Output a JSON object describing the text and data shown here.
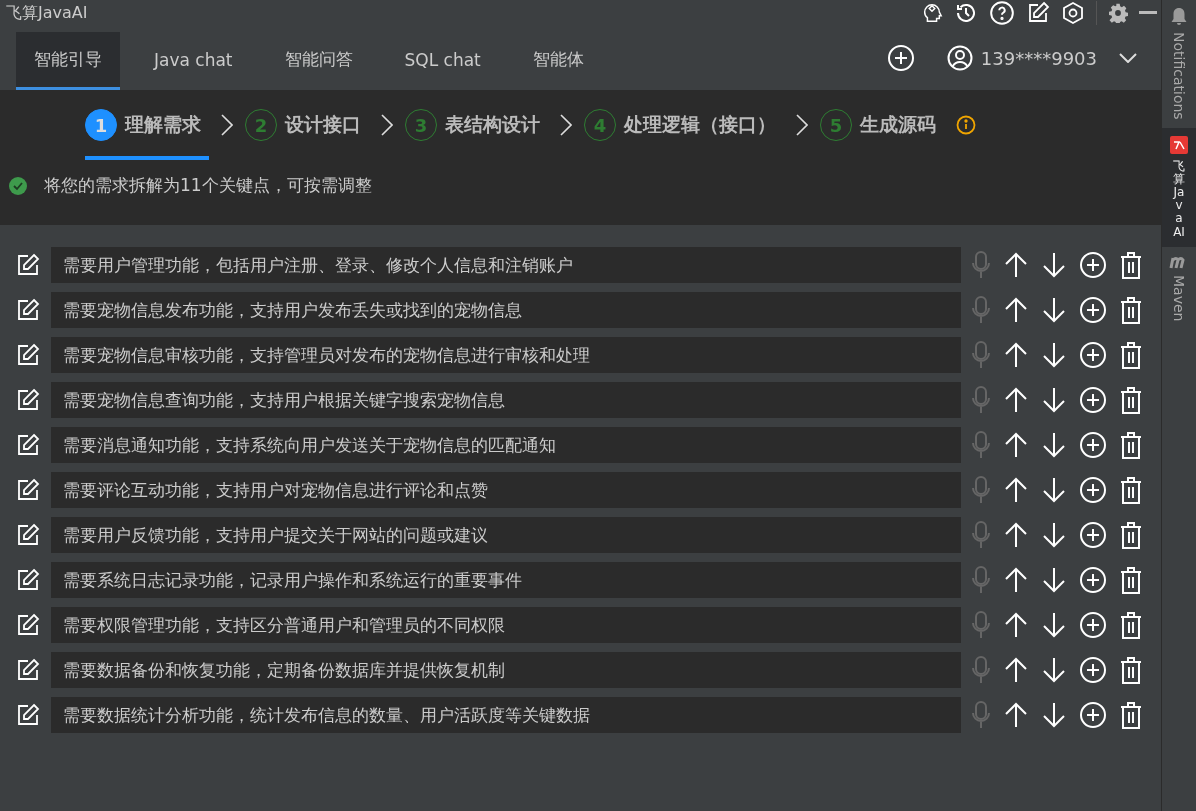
{
  "window": {
    "title": "飞算JavaAI"
  },
  "tabs": [
    {
      "label": "智能引导",
      "selected": true
    },
    {
      "label": "Java chat",
      "selected": false
    },
    {
      "label": "智能问答",
      "selected": false
    },
    {
      "label": "SQL chat",
      "selected": false
    },
    {
      "label": "智能体",
      "selected": false
    }
  ],
  "account": {
    "phone": "139****9903"
  },
  "steps": [
    {
      "number": "1",
      "label": "理解需求",
      "selected": true
    },
    {
      "number": "2",
      "label": "设计接口",
      "selected": false
    },
    {
      "number": "3",
      "label": "表结构设计",
      "selected": false
    },
    {
      "number": "4",
      "label": "处理逻辑（接口）",
      "selected": false
    },
    {
      "number": "5",
      "label": "生成源码",
      "selected": false
    }
  ],
  "status": {
    "message": "将您的需求拆解为11个关键点，可按需调整"
  },
  "requirements": [
    {
      "text": "需要用户管理功能，包括用户注册、登录、修改个人信息和注销账户"
    },
    {
      "text": "需要宠物信息发布功能，支持用户发布丢失或找到的宠物信息"
    },
    {
      "text": "需要宠物信息审核功能，支持管理员对发布的宠物信息进行审核和处理"
    },
    {
      "text": "需要宠物信息查询功能，支持用户根据关键字搜索宠物信息"
    },
    {
      "text": "需要消息通知功能，支持系统向用户发送关于宠物信息的匹配通知"
    },
    {
      "text": "需要评论互动功能，支持用户对宠物信息进行评论和点赞"
    },
    {
      "text": "需要用户反馈功能，支持用户提交关于网站的问题或建议"
    },
    {
      "text": "需要系统日志记录功能，记录用户操作和系统运行的重要事件"
    },
    {
      "text": "需要权限管理功能，支持区分普通用户和管理员的不同权限"
    },
    {
      "text": "需要数据备份和恢复功能，定期备份数据库并提供恢复机制"
    },
    {
      "text": "需要数据统计分析功能，统计发布信息的数量、用户活跃度等关键数据"
    }
  ],
  "side_tabs": [
    {
      "kind": "notifications",
      "label": "Notifications",
      "selected": false
    },
    {
      "kind": "plugin",
      "label": "飞算JavaAI",
      "selected": true
    },
    {
      "kind": "maven",
      "label": "Maven",
      "selected": false
    }
  ]
}
